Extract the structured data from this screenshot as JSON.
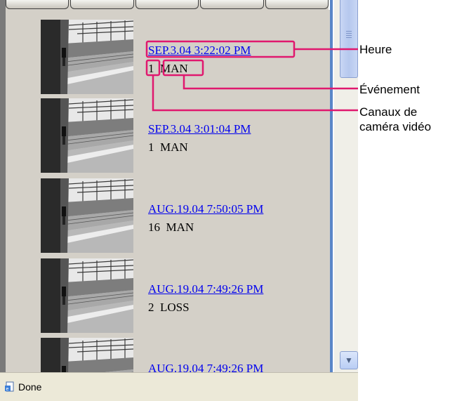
{
  "events": [
    {
      "time": "SEP.3.04 3:22:02 PM",
      "channel": "1",
      "event": "MAN"
    },
    {
      "time": "SEP.3.04 3:01:04 PM",
      "channel": "1",
      "event": "MAN"
    },
    {
      "time": "AUG.19.04 7:50:05 PM",
      "channel": "16",
      "event": "MAN"
    },
    {
      "time": "AUG.19.04 7:49:26 PM",
      "channel": "2",
      "event": "LOSS"
    },
    {
      "time": "AUG.19.04 7:49:26 PM",
      "channel": "",
      "event": ""
    }
  ],
  "status": {
    "text": "Done",
    "icon": "page-icon"
  },
  "annotations": {
    "time_label": "Heure",
    "event_label": "Événement",
    "channels_label_line1": "Canaux de",
    "channels_label_line2": "caméra vidéo"
  },
  "colors": {
    "highlight": "#e0186e",
    "link": "#0000ee",
    "panel": "#d4d0c8"
  }
}
